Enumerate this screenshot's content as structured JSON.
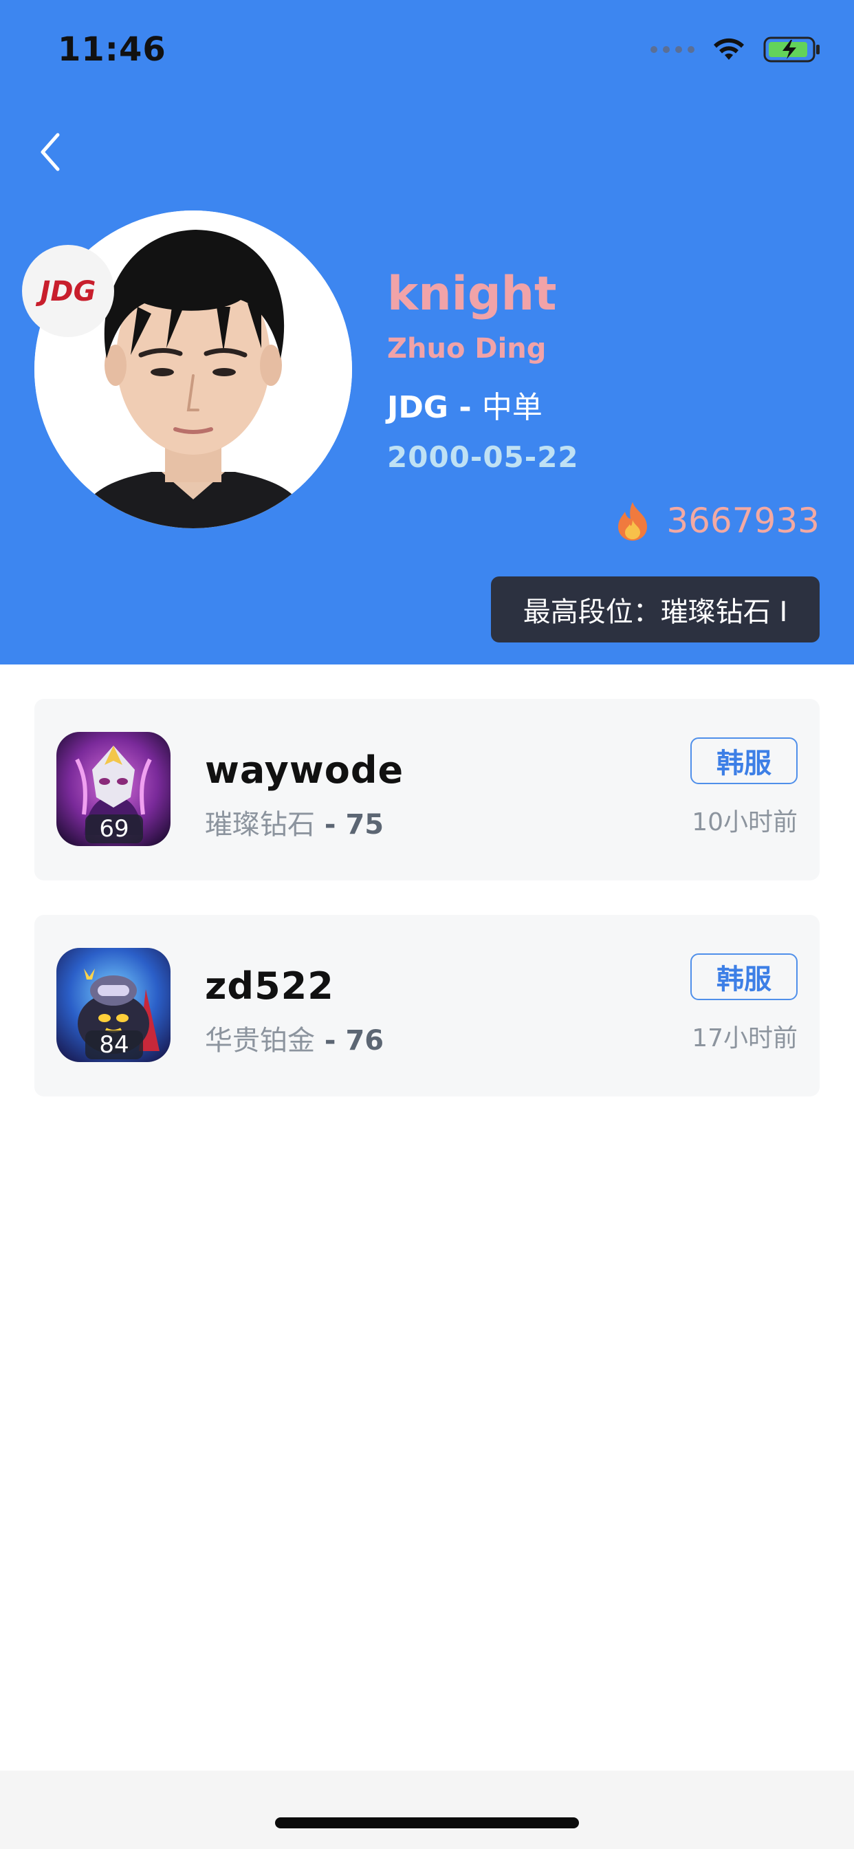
{
  "status_bar": {
    "time": "11:46"
  },
  "profile": {
    "player_name": "knight",
    "real_name": "Zhuo Ding",
    "team": "JDG",
    "separator": " - ",
    "position": "中单",
    "birthdate": "2000-05-22",
    "popularity": "3667933",
    "max_rank_text": "最高段位：璀璨钻石 I",
    "team_logo_text": "JDG"
  },
  "accounts": [
    {
      "name": "waywode",
      "rank": "璀璨钻石",
      "rank_sep": " - ",
      "rank_points": "75",
      "level": "69",
      "server": "韩服",
      "time_ago": "10小时前"
    },
    {
      "name": "zd522",
      "rank": "华贵铂金",
      "rank_sep": " - ",
      "rank_points": "76",
      "level": "84",
      "server": "韩服",
      "time_ago": "17小时前"
    }
  ],
  "colors": {
    "header_bg": "#3d86f0",
    "name_pink": "#f1a3a8",
    "birth_blue": "#bfe1f4",
    "rank_pill": "#2c3140",
    "server_blue": "#3d7fe6"
  },
  "icons": {
    "back": "chevron-left-icon",
    "fire": "fire-icon",
    "wifi": "wifi-icon",
    "battery": "battery-charging-icon"
  }
}
